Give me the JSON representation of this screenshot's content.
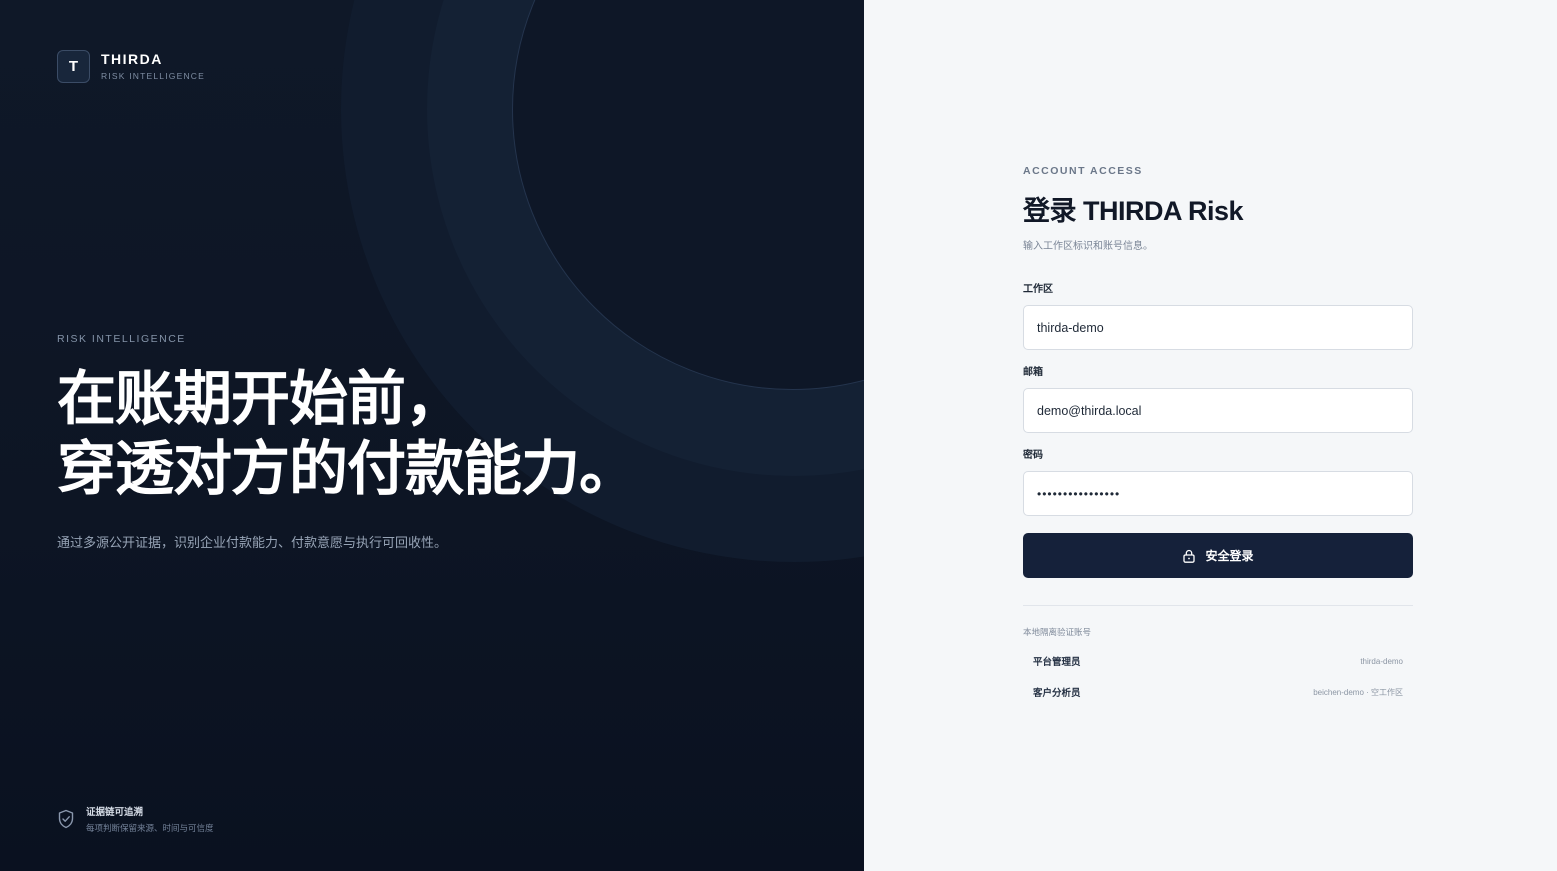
{
  "brand": {
    "mark": "T",
    "name": "THIRDA",
    "tagline": "RISK INTELLIGENCE"
  },
  "hero": {
    "eyebrow": "RISK INTELLIGENCE",
    "headline_line1": "在账期开始前，",
    "headline_line2": "穿透对方的付款能力。",
    "description": "通过多源公开证据，识别企业付款能力、付款意愿与执行可回收性。"
  },
  "trust": {
    "icon": "shield-check-icon",
    "title": "证据链可追溯",
    "subtitle": "每项判断保留来源、时间与可信度"
  },
  "login": {
    "eyebrow": "ACCOUNT ACCESS",
    "title": "登录 THIRDA Risk",
    "subtitle": "输入工作区标识和账号信息。",
    "workspace_label": "工作区",
    "workspace_value": "thirda-demo",
    "email_label": "邮箱",
    "email_value": "demo@thirda.local",
    "password_label": "密码",
    "password_value": "••••••••••••••••",
    "submit_label": "安全登录",
    "submit_icon": "lock-icon"
  },
  "demo_accounts": {
    "caption": "本地隔离验证账号",
    "items": [
      {
        "role": "平台管理员",
        "account": "thirda-demo"
      },
      {
        "role": "客户分析员",
        "account": "beichen-demo · 空工作区"
      }
    ]
  },
  "colors": {
    "left_panel_bg": "#0f1828",
    "right_panel_bg": "#f5f7f9",
    "primary_button": "#15213a",
    "heading_text": "#111827",
    "muted_text": "#7a8596"
  }
}
